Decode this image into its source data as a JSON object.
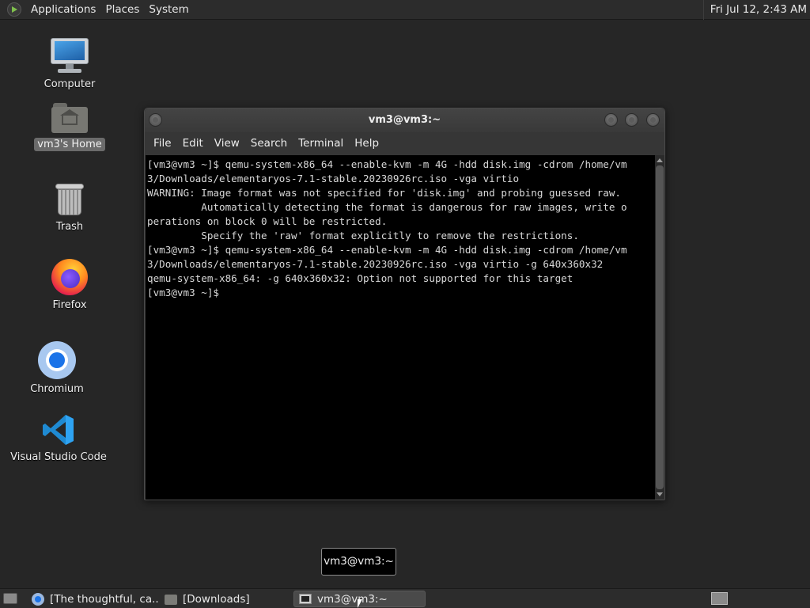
{
  "top_panel": {
    "menus": [
      "Applications",
      "Places",
      "System"
    ],
    "clock": "Fri Jul 12,  2:43 AM"
  },
  "desktop": {
    "icons": [
      {
        "label": "Computer"
      },
      {
        "label": "vm3's Home"
      },
      {
        "label": "Trash"
      },
      {
        "label": "Firefox"
      },
      {
        "label": "Chromium"
      },
      {
        "label": "Visual Studio Code"
      }
    ]
  },
  "terminal": {
    "title": "vm3@vm3:~",
    "menus": [
      "File",
      "Edit",
      "View",
      "Search",
      "Terminal",
      "Help"
    ],
    "lines": [
      "[vm3@vm3 ~]$ qemu-system-x86_64 --enable-kvm -m 4G -hdd disk.img -cdrom /home/vm",
      "3/Downloads/elementaryos-7.1-stable.20230926rc.iso -vga virtio",
      "WARNING: Image format was not specified for 'disk.img' and probing guessed raw.",
      "         Automatically detecting the format is dangerous for raw images, write o",
      "perations on block 0 will be restricted.",
      "         Specify the 'raw' format explicitly to remove the restrictions.",
      "[vm3@vm3 ~]$ qemu-system-x86_64 --enable-kvm -m 4G -hdd disk.img -cdrom /home/vm",
      "3/Downloads/elementaryos-7.1-stable.20230926rc.iso -vga virtio -g 640x360x32",
      "qemu-system-x86_64: -g 640x360x32: Option not supported for this target",
      "[vm3@vm3 ~]$ "
    ]
  },
  "tooltip": {
    "text": "vm3@vm3:~"
  },
  "taskbar": {
    "tasks": [
      {
        "label": "[The thoughtful, ca...",
        "icon": "chromium-icon"
      },
      {
        "label": "[Downloads]",
        "icon": "folder-icon"
      },
      {
        "label": "vm3@vm3:~",
        "icon": "terminal-icon"
      }
    ]
  }
}
